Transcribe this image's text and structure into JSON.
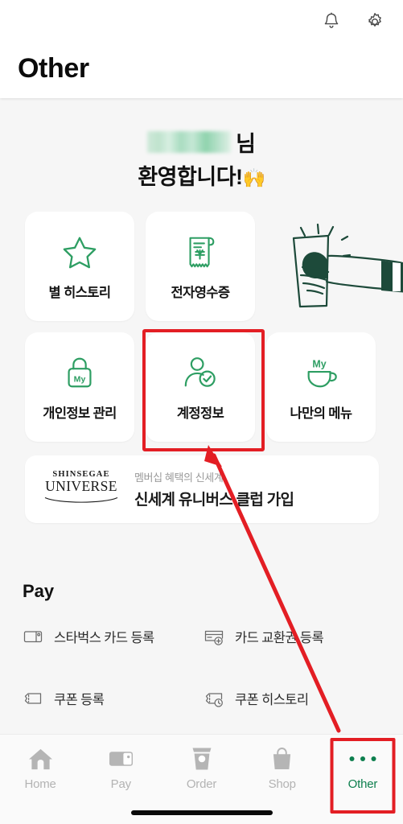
{
  "header": {
    "title": "Other",
    "notification_icon": "bell-icon",
    "settings_icon": "gear-icon"
  },
  "welcome": {
    "name_redacted": "",
    "honorific": "님",
    "greeting": "환영합니다!",
    "emoji": "🙌"
  },
  "illustration": {
    "name": "hand-holding-cup-illustration"
  },
  "cards": [
    {
      "label": "별 히스토리",
      "icon": "star-icon",
      "highlighted": false
    },
    {
      "label": "전자영수증",
      "icon": "receipt-icon",
      "highlighted": false
    },
    {
      "label": "개인정보 관리",
      "icon": "lock-my-icon",
      "highlighted": false
    },
    {
      "label": "계정정보",
      "icon": "person-check-icon",
      "highlighted": true
    },
    {
      "label": "나만의 메뉴",
      "icon": "cup-my-icon",
      "highlighted": false
    }
  ],
  "banner": {
    "logo_top": "SHINSEGAE",
    "logo_bottom": "UNIVERSE",
    "subtitle": "멤버십 혜택의 신세계",
    "title": "신세계 유니버스 클럽 가입"
  },
  "pay": {
    "section_title": "Pay",
    "items": [
      {
        "label": "스타벅스 카드 등록",
        "icon": "card-register-icon"
      },
      {
        "label": "카드 교환권 등록",
        "icon": "card-voucher-add-icon"
      },
      {
        "label": "쿠폰 등록",
        "icon": "coupon-icon"
      },
      {
        "label": "쿠폰 히스토리",
        "icon": "coupon-history-icon"
      }
    ]
  },
  "bottom_nav": {
    "items": [
      {
        "label": "Home",
        "icon": "home-icon",
        "active": false,
        "highlighted": false
      },
      {
        "label": "Pay",
        "icon": "card-icon",
        "active": false,
        "highlighted": false
      },
      {
        "label": "Order",
        "icon": "cup-icon",
        "active": false,
        "highlighted": false
      },
      {
        "label": "Shop",
        "icon": "bag-icon",
        "active": false,
        "highlighted": false
      },
      {
        "label": "Other",
        "icon": "ellipsis-icon",
        "active": true,
        "highlighted": true
      }
    ]
  },
  "colors": {
    "accent_green": "#2e9e63",
    "active_green": "#0d7f4e",
    "annotation_red": "#e31e24",
    "background": "#f6f6f6",
    "card": "#ffffff",
    "text_primary": "#111111",
    "text_muted": "#b3b3b3"
  }
}
